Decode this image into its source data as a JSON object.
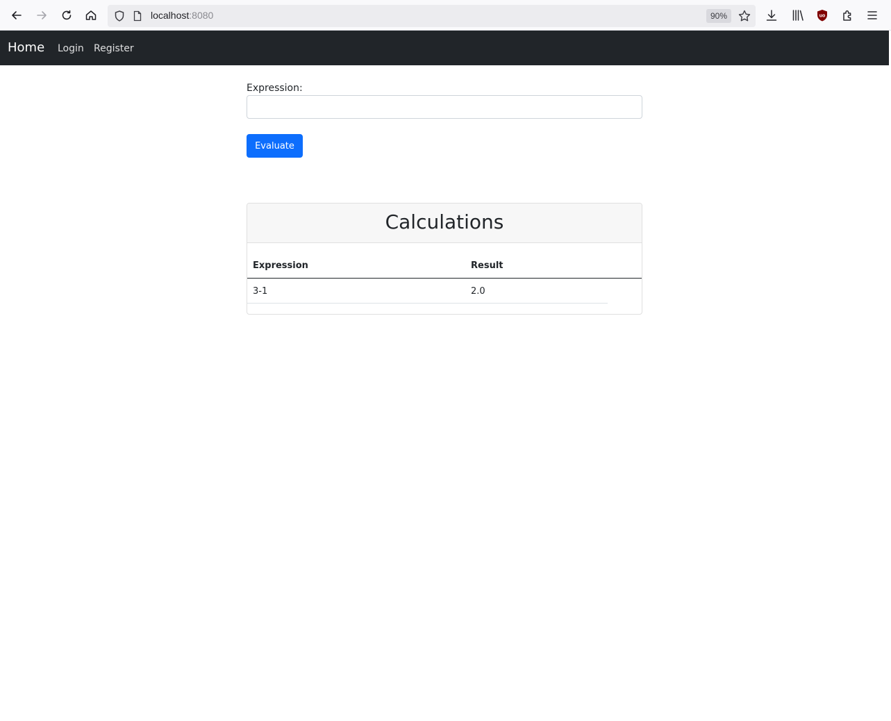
{
  "browser": {
    "url_host": "localhost",
    "url_port": ":8080",
    "zoom": "90%"
  },
  "navbar": {
    "brand": "Home",
    "links": [
      "Login",
      "Register"
    ]
  },
  "form": {
    "label": "Expression:",
    "input_value": "",
    "button_label": "Evaluate"
  },
  "calculations": {
    "title": "Calculations",
    "columns": [
      "Expression",
      "Result"
    ],
    "rows": [
      {
        "expression": "3-1",
        "result": "2.0"
      }
    ]
  },
  "colors": {
    "navbar_bg": "#212529",
    "primary": "#0d6efd"
  }
}
